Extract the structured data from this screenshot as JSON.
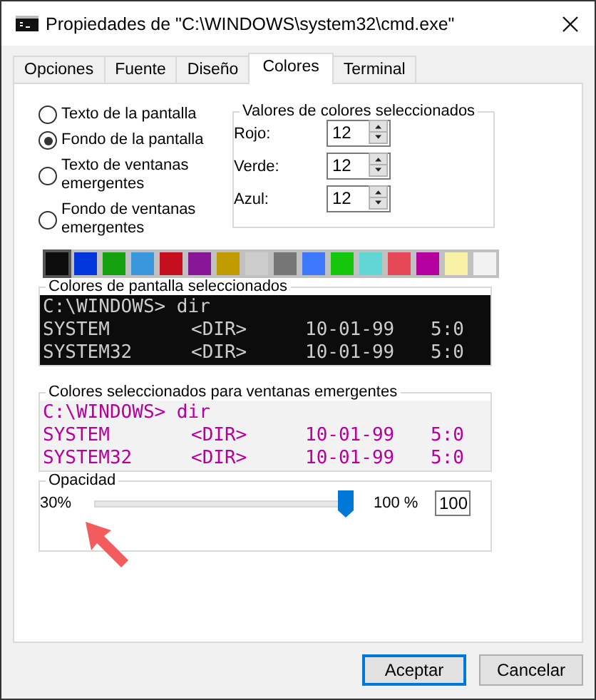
{
  "window": {
    "title": "Propiedades de \"C:\\WINDOWS\\system32\\cmd.exe\""
  },
  "tabs": [
    {
      "label": "Opciones",
      "selected": false
    },
    {
      "label": "Fuente",
      "selected": false
    },
    {
      "label": "Diseño",
      "selected": false
    },
    {
      "label": "Colores",
      "selected": true
    },
    {
      "label": "Terminal",
      "selected": false
    }
  ],
  "targets": [
    {
      "label": "Texto de la pantalla",
      "selected": false
    },
    {
      "label": "Fondo de la pantalla",
      "selected": true
    },
    {
      "label": "Texto de ventanas emergentes",
      "selected": false
    },
    {
      "label": "Fondo de ventanas emergentes",
      "selected": false
    }
  ],
  "color_values": {
    "title": "Valores de colores seleccionados",
    "fields": [
      {
        "label": "Rojo:",
        "value": "12"
      },
      {
        "label": "Verde:",
        "value": "12"
      },
      {
        "label": "Azul:",
        "value": "12"
      }
    ]
  },
  "swatches": [
    {
      "color": "#0c0c0c",
      "selected": true
    },
    {
      "color": "#0037da",
      "selected": false
    },
    {
      "color": "#13a10e",
      "selected": false
    },
    {
      "color": "#3a96dd",
      "selected": false
    },
    {
      "color": "#c50f1f",
      "selected": false
    },
    {
      "color": "#881798",
      "selected": false
    },
    {
      "color": "#c19c00",
      "selected": false
    },
    {
      "color": "#cccccc",
      "selected": false
    },
    {
      "color": "#767676",
      "selected": false
    },
    {
      "color": "#3b78ff",
      "selected": false
    },
    {
      "color": "#16c60c",
      "selected": false
    },
    {
      "color": "#61d6d6",
      "selected": false
    },
    {
      "color": "#e74856",
      "selected": false
    },
    {
      "color": "#b4009e",
      "selected": false
    },
    {
      "color": "#f9f1a5",
      "selected": false
    },
    {
      "color": "#f2f2f2",
      "selected": false
    }
  ],
  "previews": [
    {
      "title": "Colores de pantalla seleccionados",
      "kind": "screen",
      "prompt": "C:\\WINDOWS> dir",
      "rows": [
        [
          "SYSTEM",
          "<DIR>",
          "10-01-99",
          "5:0"
        ],
        [
          "SYSTEM32",
          "<DIR>",
          "10-01-99",
          "5:0"
        ]
      ]
    },
    {
      "title": "Colores seleccionados para ventanas emergentes",
      "kind": "popup",
      "prompt": "C:\\WINDOWS> dir",
      "rows": [
        [
          "SYSTEM",
          "<DIR>",
          "10-01-99",
          "5:0"
        ],
        [
          "SYSTEM32",
          "<DIR>",
          "10-01-99",
          "5:0"
        ]
      ]
    }
  ],
  "opacity": {
    "title": "Opacidad",
    "min_label": "30%",
    "level": 1,
    "value_label": "100 %",
    "value": "100"
  },
  "buttons": [
    {
      "label": "Aceptar",
      "default": true
    },
    {
      "label": "Cancelar",
      "default": false
    }
  ]
}
